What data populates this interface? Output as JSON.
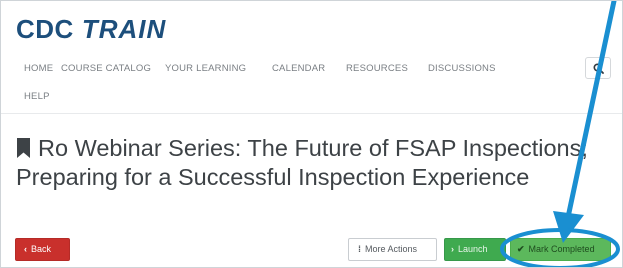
{
  "logo": {
    "cdc": "CDC",
    "train": "TRAIN"
  },
  "nav": {
    "items": [
      {
        "label": "HOME"
      },
      {
        "label": "COURSE CATALOG"
      },
      {
        "label": "YOUR LEARNING"
      },
      {
        "label": "CALENDAR"
      },
      {
        "label": "RESOURCES"
      },
      {
        "label": "DISCUSSIONS"
      },
      {
        "label": "HELP"
      }
    ],
    "search_icon": "search-icon"
  },
  "course": {
    "title": "Ro Webinar Series: The Future of FSAP Inspections; Preparing for a Successful Inspection Experience",
    "title_icon": "bookmark-icon"
  },
  "actions": {
    "back_label": "Back",
    "back_glyph": "‹",
    "more_label": "More Actions",
    "more_glyph": "⁞",
    "launch_label": "Launch",
    "launch_glyph": "›",
    "mark_label": "Mark Completed",
    "mark_glyph": "✔"
  },
  "colors": {
    "brand": "#1d4f7c",
    "back": "#c9302c",
    "launch": "#3faa4f",
    "mark": "#5cb85c",
    "annotation": "#1a8fd1"
  }
}
